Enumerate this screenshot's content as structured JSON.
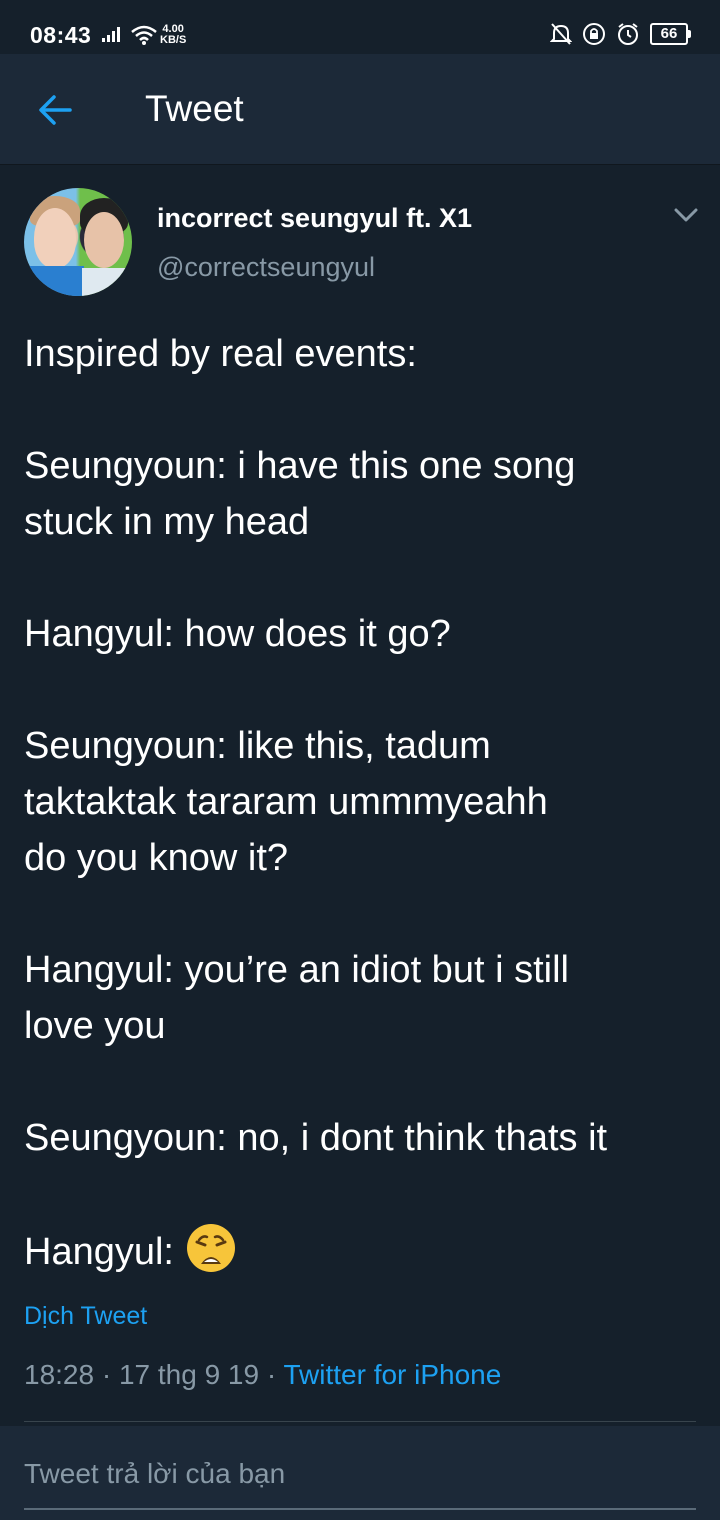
{
  "status_bar": {
    "time": "08:43",
    "net_speed_value": "4.00",
    "net_speed_unit": "KB/S",
    "battery": "66",
    "icons": [
      "signal-icon",
      "wifi-icon",
      "mute-icon",
      "lock-rotation-icon",
      "alarm-icon",
      "battery-icon"
    ]
  },
  "header": {
    "title": "Tweet",
    "back_icon": "arrow-left-icon"
  },
  "tweet": {
    "author_name": "incorrect seungyul ft. X1",
    "author_handle": "@correctseungyul",
    "lines": [
      "Inspired by real events:",
      "",
      "Seungyoun: i have this one song\nstuck in my head",
      "",
      "Hangyul: how does it go?",
      "",
      "Seungyoun: like this, tadum\ntaktaktak tararam ummmyeahh\ndo you know it?",
      "",
      "Hangyul: you’re an idiot but i still\nlove you",
      "",
      "Seungyoun: no, i dont think thats it",
      "",
      "Hangyul: "
    ],
    "emoji_icon": "weary-face-icon",
    "translate_label": "Dịch Tweet",
    "timestamp": "18:28 · 17 thg 9 19 · ",
    "source": "Twitter for iPhone"
  },
  "reply": {
    "placeholder": "Tweet trả lời của bạn"
  },
  "colors": {
    "background": "#15202b",
    "header": "#1c2938",
    "accent": "#1da1f2",
    "secondary_text": "#8899a6"
  }
}
